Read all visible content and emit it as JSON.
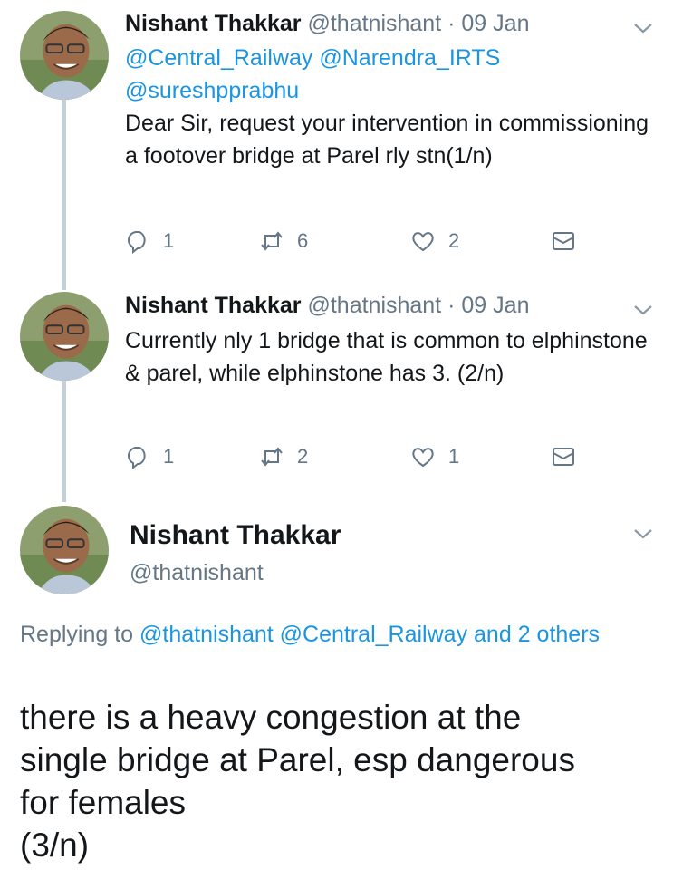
{
  "tweets": [
    {
      "name": "Nishant Thakkar",
      "handle": "@thatnishant",
      "separator": "·",
      "date": "09 Jan",
      "mentions": [
        "@Central_Railway",
        "@Narendra_IRTS",
        "@sureshpprabhu"
      ],
      "text": "Dear Sir, request your intervention in commissioning a footover bridge at Parel rly stn(1/n)",
      "replies": "1",
      "retweets": "6",
      "likes": "2"
    },
    {
      "name": "Nishant Thakkar",
      "handle": "@thatnishant",
      "separator": "·",
      "date": "09 Jan",
      "text": "Currently nly 1 bridge that is common to elphinstone & parel, while elphinstone has 3. (2/n)",
      "replies": "1",
      "retweets": "2",
      "likes": "1"
    }
  ],
  "main_tweet": {
    "name": "Nishant Thakkar",
    "handle": "@thatnishant",
    "replying_prefix": "Replying to",
    "replying_mentions": "@thatnishant @Central_Railway",
    "replying_suffix": "and 2 others",
    "text_lines": [
      "there is a heavy congestion at the",
      "single bridge at Parel, esp dangerous",
      "for females",
      "(3/n)"
    ]
  },
  "colors": {
    "link": "#1b95e0",
    "secondary": "#657786",
    "thread_line": "#c4cfd6"
  },
  "icons": [
    "reply-icon",
    "retweet-icon",
    "like-icon",
    "dm-icon",
    "chevron-down-icon",
    "avatar"
  ]
}
